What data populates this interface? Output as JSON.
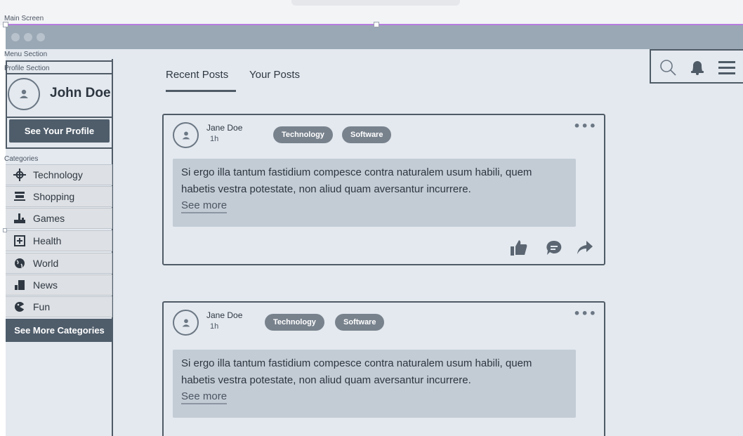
{
  "labels": {
    "main_screen": "Main Screen",
    "menu_section": "Menu Section",
    "profile_section": "Profile Section",
    "categories": "Categories"
  },
  "profile": {
    "name": "John Doe",
    "button_label": "See Your Profile"
  },
  "categories": {
    "items": [
      {
        "label": "Technology",
        "icon": "technology-icon"
      },
      {
        "label": "Shopping",
        "icon": "shopping-cart-icon"
      },
      {
        "label": "Games",
        "icon": "joystick-icon"
      },
      {
        "label": "Health",
        "icon": "health-plus-icon"
      },
      {
        "label": "World",
        "icon": "globe-icon"
      },
      {
        "label": "News",
        "icon": "news-icon"
      },
      {
        "label": "Fun",
        "icon": "fun-icon"
      }
    ],
    "more_label": "See More Categories"
  },
  "tabs": [
    {
      "label": "Recent Posts",
      "active": true
    },
    {
      "label": "Your Posts",
      "active": false
    }
  ],
  "toolbar": {
    "icons": [
      "search-icon",
      "bell-icon",
      "hamburger-menu-icon"
    ]
  },
  "posts": [
    {
      "author": "Jane Doe",
      "time": "1h",
      "tags": [
        "Technology",
        "Software"
      ],
      "text": "Si ergo illa tantum fastidium compesce contra naturalem usum habili, quem habetis vestra potestate, non aliud quam aversantur incurrere.",
      "see_more": "See more"
    },
    {
      "author": "Jane Doe",
      "time": "1h",
      "tags": [
        "Technology",
        "Software"
      ],
      "text": "Si ergo illa tantum fastidium compesce contra naturalem usum habili, quem habetis vestra potestate, non aliud quam aversantur incurrere.",
      "see_more": "See more"
    }
  ],
  "colors": {
    "background": "#e4e9ef",
    "dark_button": "#4f5d6b",
    "tag": "#78828d",
    "post_body": "#c3ccd5",
    "selection": "#b77ce0"
  }
}
